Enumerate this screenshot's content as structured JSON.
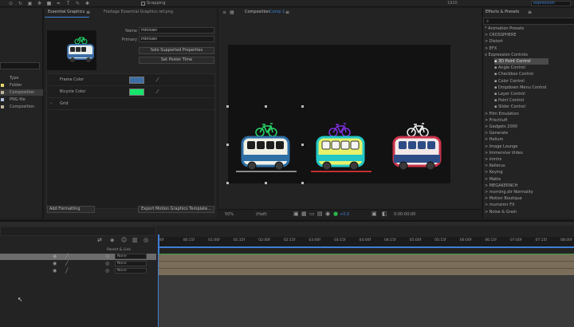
{
  "toolbar": {
    "snapping_label": "Snapping",
    "workspace_label": "1920",
    "search_value": "expression"
  },
  "project": {
    "items": [
      {
        "name": "Type",
        "color": ""
      },
      {
        "name": "Folder",
        "color": "#e3d76b"
      },
      {
        "name": "Composition",
        "color": "#c1b29a"
      },
      {
        "name": "PNG file",
        "color": "#b1c0e0"
      },
      {
        "name": "Composition",
        "color": "#c1b29a"
      }
    ]
  },
  "eg": {
    "tab_label": "Essential Graphics",
    "tab2_label": "Footage Essential Graphics ref.png",
    "name_label": "Name",
    "name_value": "minivan",
    "primary_label": "Primary",
    "primary_value": "minivan",
    "solo_button": "Solo Supported Properties",
    "poster_button": "Set Poster Time",
    "props": [
      {
        "name": "Frame Color",
        "color": "#3c6ea4"
      },
      {
        "name": "Bicycle Color",
        "color": "#17e66d"
      },
      {
        "name": "Grid",
        "color": ""
      }
    ],
    "formatting_label": "Add Formatting",
    "export_button": "Export Motion Graphics Template..."
  },
  "comp": {
    "tab_label": "Composition",
    "tab_name": "Comp 1",
    "zoom": "50%",
    "resolution": "(Half)",
    "exposure": "+0.0",
    "timecode": "0:00:00:00"
  },
  "fx": {
    "title": "Effects & Presets",
    "items": [
      {
        "label": "* Animation Presets",
        "indent": 0,
        "sel": false
      },
      {
        "label": "> CROSSPHERE",
        "indent": 0,
        "sel": false
      },
      {
        "label": "> Distort",
        "indent": 0,
        "sel": false
      },
      {
        "label": "> EFX",
        "indent": 0,
        "sel": false
      },
      {
        "label": "v Expression Controls",
        "indent": 0,
        "sel": false
      },
      {
        "label": "3D Point Control",
        "indent": 1,
        "sel": true
      },
      {
        "label": "Angle Control",
        "indent": 1,
        "sel": false
      },
      {
        "label": "Checkbox Control",
        "indent": 1,
        "sel": false
      },
      {
        "label": "Color Control",
        "indent": 1,
        "sel": false
      },
      {
        "label": "Dropdown Menu Control",
        "indent": 1,
        "sel": false
      },
      {
        "label": "Layer Control",
        "indent": 1,
        "sel": false
      },
      {
        "label": "Point Control",
        "indent": 1,
        "sel": false
      },
      {
        "label": "Slider Control",
        "indent": 1,
        "sel": false
      },
      {
        "label": "> Film Emulation",
        "indent": 0,
        "sel": false
      },
      {
        "label": "> Frischluft",
        "indent": 0,
        "sel": false
      },
      {
        "label": "> Gadgets 2000",
        "indent": 0,
        "sel": false
      },
      {
        "label": "> Generate",
        "indent": 0,
        "sel": false
      },
      {
        "label": "> Helium",
        "indent": 0,
        "sel": false
      },
      {
        "label": "> Image Lounge",
        "indent": 0,
        "sel": false
      },
      {
        "label": "> Immersive Video",
        "indent": 0,
        "sel": false
      },
      {
        "label": "> imnlrs",
        "indent": 0,
        "sel": false
      },
      {
        "label": "> Kellerus",
        "indent": 0,
        "sel": false
      },
      {
        "label": "> Keying",
        "indent": 0,
        "sel": false
      },
      {
        "label": "> Matte",
        "indent": 0,
        "sel": false
      },
      {
        "label": "> MEGAKERNCH",
        "indent": 0,
        "sel": false
      },
      {
        "label": "> morning.dir Normality",
        "indent": 0,
        "sel": false
      },
      {
        "label": "> Motion Boutique",
        "indent": 0,
        "sel": false
      },
      {
        "label": "> mumsimr FX",
        "indent": 0,
        "sel": false
      },
      {
        "label": "> Noise & Grain",
        "indent": 0,
        "sel": false
      }
    ]
  },
  "timeline": {
    "ticks": [
      "00f",
      "00:15f",
      "01:00f",
      "01:15f",
      "02:00f",
      "02:15f",
      "03:00f",
      "03:15f",
      "04:00f",
      "04:15f",
      "05:00f",
      "05:15f",
      "06:00f",
      "06:15f",
      "07:00f",
      "07:15f",
      "08:00f"
    ],
    "layer_header": "Parent & Link",
    "layers": [
      {
        "parent": "None"
      },
      {
        "parent": "None"
      },
      {
        "parent": "None"
      }
    ]
  },
  "colors": {
    "accent": "#3f7fd6",
    "selection": "#4a4a4a",
    "layer_bar": "#7a6d5a",
    "bar_green": "#3aa044"
  }
}
